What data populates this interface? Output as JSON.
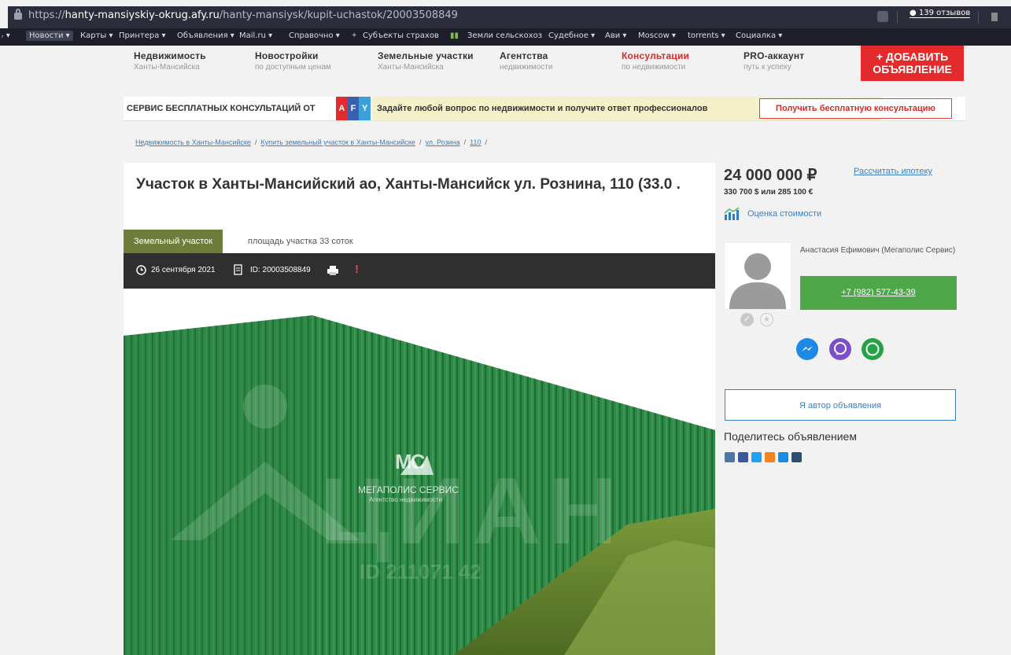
{
  "browser": {
    "url_prefix": "https://",
    "url_domain": "hanty-mansiyskiy-okrug.afy.ru",
    "url_path": "/hanty-mansiysk/kupit-uchastok/20003508849",
    "reviews": "139 отзывов"
  },
  "bookmarks": [
    "Новости ▾",
    "Карты ▾",
    "Принтера ▾",
    "Объявления ▾",
    "Mail.ru ▾",
    "Справочно ▾",
    "Субъекты страхов",
    "Земли сельскохоз",
    "Судебное ▾",
    "Ави ▾",
    "Moscow ▾",
    "torrents ▾",
    "Социалка ▾"
  ],
  "nav": [
    {
      "title": "Недвижимость",
      "sub": "Ханты-Мансийска"
    },
    {
      "title": "Новостройки",
      "sub": "по доступным ценам"
    },
    {
      "title": "Земельные участки",
      "sub": "Ханты-Мансийска"
    },
    {
      "title": "Агентства",
      "sub": "недвижимости"
    },
    {
      "title": "Консультации",
      "sub": "по недвижимости"
    },
    {
      "title": "PRO-аккаунт",
      "sub": "путь к успеху"
    }
  ],
  "add_button": {
    "line1": "+ ДОБАВИТЬ",
    "line2": "ОБЪЯВЛЕНИЕ"
  },
  "banner": {
    "left": "СЕРВИС БЕСПЛАТНЫХ КОНСУЛЬТАЦИЙ ОТ",
    "logo": [
      "A",
      "F",
      "Y"
    ],
    "middle": "Задайте любой вопрос по недвижимости и получите ответ профессионалов",
    "button": "Получить бесплатную консультацию"
  },
  "breadcrumbs": [
    "Недвижимость в Ханты-Мансийске",
    "Купить земельный участок в Ханты-Мансийске",
    "ул. Розина",
    "110"
  ],
  "listing": {
    "title": "Участок в Ханты-Мансийский ао, Ханты-Мансийск ул. Рознина, 110 (33.0 .",
    "tag": "Земельный участок",
    "area": "площадь участка 33 соток",
    "date": "26 сентября 2021",
    "id": "ID: 20003508849",
    "alert": "!"
  },
  "photo": {
    "logo_mark": "MC",
    "company": "МЕГАПОЛИС СЕРВИС",
    "company_sub": "Агентство недвижимости",
    "watermark": "ЦИАН",
    "watermark_id": "ID 211071 42"
  },
  "side": {
    "price": "24 000 000 ₽",
    "price_alt": "330 700 $ или 285 100 €",
    "mortgage": "Рассчитать ипотеку",
    "estimate": "Оценка стоимости",
    "agent": "Анастасия Ефимович (Мегаполис Сервис)",
    "phone": "+7 (982) 577-43-39",
    "author": "Я автор объявления",
    "share": "Поделитесь объявлением"
  },
  "colors": {
    "brand_red": "#e42a2a",
    "accent_green": "#4ea84a",
    "link_blue": "#3a7fc4",
    "tag_olive": "#6e7d3a"
  }
}
